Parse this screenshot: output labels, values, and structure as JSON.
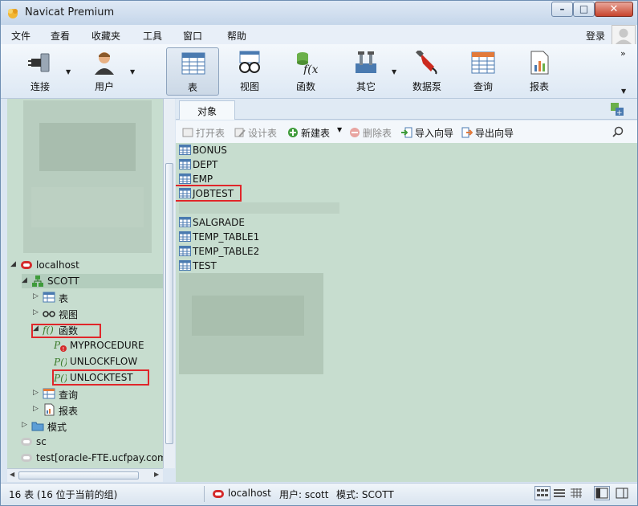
{
  "window": {
    "title": "Navicat Premium",
    "controls": {
      "minimize": "–",
      "maximize": "□",
      "close": "✕"
    }
  },
  "menu": {
    "items": [
      "文件",
      "查看",
      "收藏夹",
      "工具",
      "窗口",
      "帮助"
    ],
    "login": "登录"
  },
  "toolbar": {
    "buttons": [
      {
        "label": "连接",
        "icon": "plug-icon",
        "has_dropdown": true
      },
      {
        "label": "用户",
        "icon": "user-icon",
        "has_dropdown": true
      },
      {
        "label": "表",
        "icon": "table-icon",
        "active": true
      },
      {
        "label": "视图",
        "icon": "glasses-icon"
      },
      {
        "label": "函数",
        "icon": "function-icon"
      },
      {
        "label": "其它",
        "icon": "tools-icon",
        "has_dropdown": true
      },
      {
        "label": "数据泵",
        "icon": "fuel-pump-icon"
      },
      {
        "label": "查询",
        "icon": "query-table-icon"
      },
      {
        "label": "报表",
        "icon": "report-icon"
      }
    ],
    "more": "»"
  },
  "tree": {
    "connection": "localhost",
    "schema": "SCOTT",
    "folders": {
      "tables": "表",
      "views": "视图",
      "functions": "函数",
      "queries": "查询",
      "reports": "报表",
      "models": "模式"
    },
    "functions": [
      "MYPROCEDURE",
      "UNLOCKFLOW",
      "UNLOCKTEST"
    ],
    "other_connections": [
      "sc",
      "test[oracle-FTE.ucfpay.com"
    ]
  },
  "objects": {
    "tab_label": "对象",
    "toolbar": {
      "open": "打开表",
      "design": "设计表",
      "new": "新建表",
      "delete": "删除表",
      "import": "导入向导",
      "export": "导出向导"
    },
    "tables": [
      "BONUS",
      "DEPT",
      "EMP",
      "JOBTEST",
      "SALGRADE",
      "TEMP_TABLE1",
      "TEMP_TABLE2",
      "TEST"
    ]
  },
  "status": {
    "count": "16 表 (16 位于当前的组)",
    "connection": "localhost",
    "user": "用户: scott",
    "schema": "模式: SCOTT"
  },
  "colors": {
    "highlight": "#e0262a",
    "list_bg": "#c7ddcf",
    "accent": "#4a7ab0"
  }
}
